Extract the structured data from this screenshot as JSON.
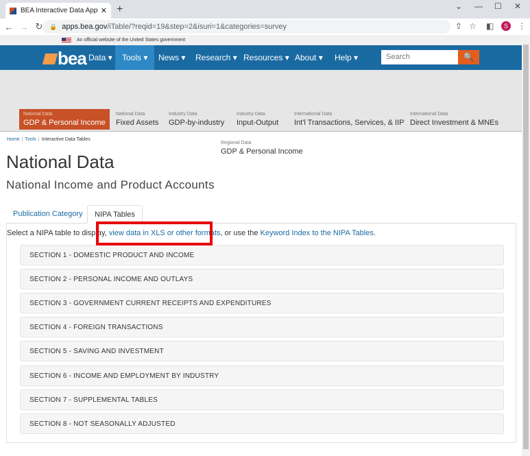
{
  "browser": {
    "tab_title": "BEA Interactive Data Application",
    "url_host": "apps.bea.gov",
    "url_path": "/iTable/?reqid=19&step=2&isuri=1&categories=survey",
    "profile_initial": "S"
  },
  "gov_banner": "An official website of the United States government",
  "logo": "bea",
  "nav": {
    "items": [
      "Data",
      "Tools",
      "News",
      "Research",
      "Resources",
      "About",
      "Help"
    ],
    "search_placeholder": "Search"
  },
  "subnav": [
    {
      "cat": "National Data",
      "label": "GDP & Personal Income"
    },
    {
      "cat": "National Data",
      "label": "Fixed Assets"
    },
    {
      "cat": "Industry Data",
      "label": "GDP-by-industry"
    },
    {
      "cat": "Industry Data",
      "label": "Input-Output"
    },
    {
      "cat": "International Data",
      "label": "Int'l Transactions, Services, & IIP"
    },
    {
      "cat": "International Data",
      "label": "Direct Investment & MNEs"
    },
    {
      "cat": "Regional Data",
      "label": "GDP & Personal Income"
    }
  ],
  "breadcrumbs": [
    "Home",
    "Tools",
    "Interactive Data Tables"
  ],
  "title": "National Data",
  "subtitle": "National Income and Product Accounts",
  "page_tabs": [
    "Publication Category",
    "NIPA Tables"
  ],
  "intro": {
    "before": "Select a NIPA table to display, ",
    "link1": "view data in XLS or other formats",
    "middle": ", or use the ",
    "link2": "Keyword Index to the NIPA Tables",
    "after": "."
  },
  "sections": [
    "SECTION 1 - DOMESTIC PRODUCT AND INCOME",
    "SECTION 2 - PERSONAL INCOME AND OUTLAYS",
    "SECTION 3 - GOVERNMENT CURRENT RECEIPTS AND EXPENDITURES",
    "SECTION 4 - FOREIGN TRANSACTIONS",
    "SECTION 5 - SAVING AND INVESTMENT",
    "SECTION 6 - INCOME AND EMPLOYMENT BY INDUSTRY",
    "SECTION 7 - SUPPLEMENTAL TABLES",
    "SECTION 8 - NOT SEASONALLY ADJUSTED"
  ]
}
